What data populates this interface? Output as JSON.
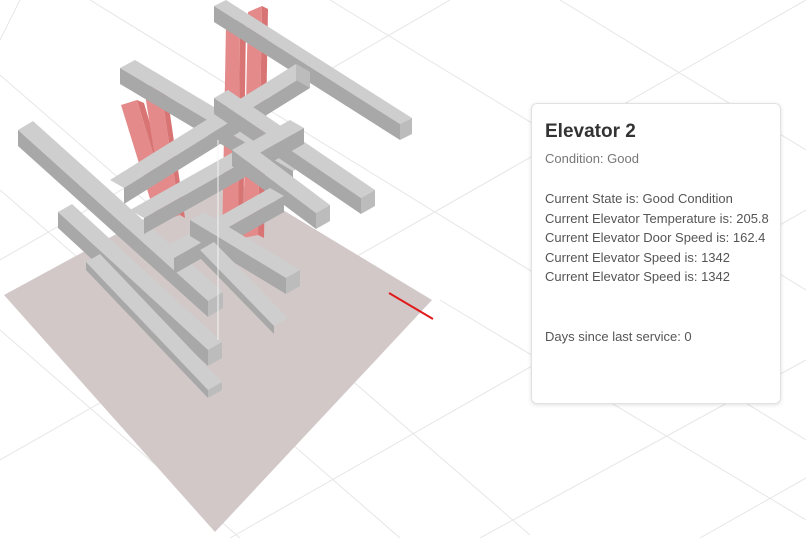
{
  "card": {
    "title": "Elevator 2",
    "subtitle": "Condition: Good",
    "lines": [
      "Current State is: Good Condition",
      "Current Elevator Temperature is: 205.8",
      "Current Elevator Door Speed is: 162.4",
      "Current Elevator Speed is: 1342",
      "Current Elevator Speed is: 1342"
    ],
    "footer": "Days since last service: 0"
  },
  "colors": {
    "background": "#ffffff",
    "grid": "#e4e4e4",
    "floor": "#d2c8c8",
    "beam_top": "#cecece",
    "beam_side": "#a8a8a8",
    "beam_end": "#bcbcbc",
    "shaft": "#e58a8a",
    "axis": "#e01b1b"
  }
}
